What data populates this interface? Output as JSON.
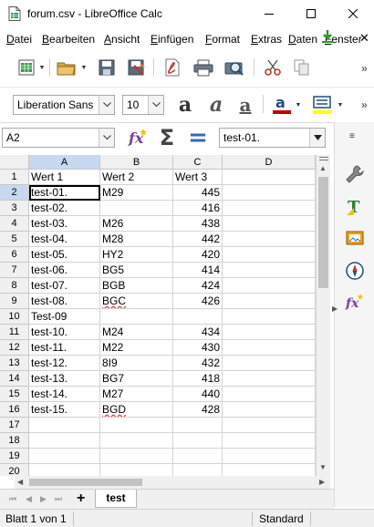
{
  "window": {
    "title": "forum.csv - LibreOffice Calc",
    "app_icon": "calc-doc-icon"
  },
  "menu": {
    "items": [
      {
        "label": "Datei",
        "underline": "D",
        "rest": "atei"
      },
      {
        "label": "Bearbeiten",
        "underline": "B",
        "rest": "earbeiten"
      },
      {
        "label": "Ansicht",
        "underline": "A",
        "rest": "nsicht"
      },
      {
        "label": "Einfügen",
        "underline": "E",
        "rest": "infügen"
      },
      {
        "label": "Format",
        "underline": "F",
        "rest": "ormat"
      },
      {
        "label": "Extras",
        "underline": "E",
        "rest": "xtras"
      },
      {
        "label": "Daten",
        "underline": "D",
        "rest": "aten"
      },
      {
        "label": "Fenster",
        "underline": "F",
        "rest": "enster"
      }
    ]
  },
  "format_toolbar": {
    "font_name": "Liberation Sans",
    "font_size": "10"
  },
  "formula_bar": {
    "name_box": "A2",
    "content": "test-01.",
    "function_wizard_icon": "fx-icon",
    "sum_icon": "sigma-icon",
    "formula_icon": "equals-icon"
  },
  "sheet": {
    "columns": [
      "A",
      "B",
      "C",
      "D"
    ],
    "selected_column": "A",
    "selected_row": "2",
    "row_numbers": [
      "1",
      "2",
      "3",
      "4",
      "5",
      "6",
      "7",
      "8",
      "9",
      "10",
      "11",
      "12",
      "13",
      "14",
      "15",
      "16",
      "17",
      "18",
      "19",
      "20"
    ],
    "rows": [
      {
        "a": "Wert 1",
        "b": "Wert 2",
        "c": "Wert 3",
        "c_num": false
      },
      {
        "a": "test-01.",
        "b": "M29",
        "c": "445",
        "c_num": true
      },
      {
        "a": "test-02.",
        "b": "",
        "c": "416",
        "c_num": true
      },
      {
        "a": "test-03.",
        "b": "M26",
        "c": "438",
        "c_num": true
      },
      {
        "a": "test-04.",
        "b": "M28",
        "c": "442",
        "c_num": true
      },
      {
        "a": "test-05.",
        "b": "HY2",
        "c": "420",
        "c_num": true
      },
      {
        "a": "test-06.",
        "b": "BG5",
        "c": "414",
        "c_num": true
      },
      {
        "a": "test-07.",
        "b": "BGB",
        "c": "424",
        "c_num": true
      },
      {
        "a": "test-08.",
        "b": "BGC",
        "c": "426",
        "c_num": true,
        "b_spell": true
      },
      {
        "a": "Test-09",
        "b": "",
        "c": "",
        "c_num": true
      },
      {
        "a": "test-10.",
        "b": "M24",
        "c": "434",
        "c_num": true
      },
      {
        "a": "test-11.",
        "b": "M22",
        "c": "430",
        "c_num": true
      },
      {
        "a": "test-12.",
        "b": "8I9",
        "c": "432",
        "c_num": true
      },
      {
        "a": "test-13.",
        "b": "BG7",
        "c": "418",
        "c_num": true
      },
      {
        "a": "test-14.",
        "b": "M27",
        "c": "440",
        "c_num": true
      },
      {
        "a": "test-15.",
        "b": "BGD",
        "c": "428",
        "c_num": true,
        "b_spell": true
      },
      {
        "a": "",
        "b": "",
        "c": "",
        "c_num": true
      },
      {
        "a": "",
        "b": "",
        "c": "",
        "c_num": true
      },
      {
        "a": "",
        "b": "",
        "c": "",
        "c_num": true
      },
      {
        "a": "",
        "b": "",
        "c": "",
        "c_num": true
      }
    ]
  },
  "tabs": {
    "add_label": "+",
    "sheets": [
      "test"
    ],
    "active": "test"
  },
  "status": {
    "sheet_info": "Blatt 1 von 1",
    "page_style": "Standard"
  },
  "colors": {
    "accent_selection": "#c6d9f0",
    "font_color": "#c00000",
    "highlight": "#ffff00",
    "spell_error": "#e03030"
  }
}
